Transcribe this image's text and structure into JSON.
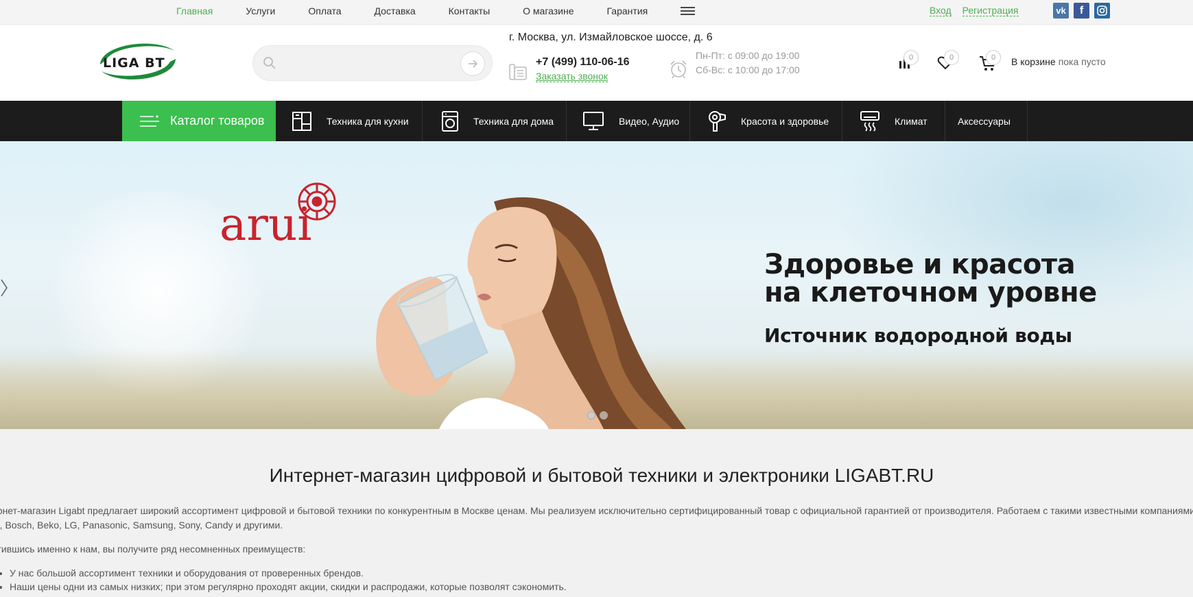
{
  "topnav": {
    "items": [
      {
        "label": "Главная",
        "active": true
      },
      {
        "label": "Услуги"
      },
      {
        "label": "Оплата"
      },
      {
        "label": "Доставка"
      },
      {
        "label": "Контакты"
      },
      {
        "label": "О магазине"
      },
      {
        "label": "Гарантия"
      }
    ],
    "menu_icon": "hamburger-icon",
    "login": "Вход",
    "register": "Регистрация",
    "social": [
      "vk-icon",
      "facebook-icon",
      "instagram-icon"
    ]
  },
  "header": {
    "logo_text": "LIGA BT",
    "search": {
      "placeholder": "",
      "value": ""
    },
    "address": "г. Москва, ул. Измайловское шоссе, д. 6",
    "phone": "+7 (499) 110-06-16",
    "callback": "Заказать звонок",
    "hours_weekdays": "Пн-Пт: с 09:00 до 19:00",
    "hours_weekend": "Сб-Вс: с 10:00 до 17:00",
    "compare_count": "0",
    "favorites_count": "0",
    "cart_count": "0",
    "cart_label": "В корзине",
    "cart_status": "пока пусто"
  },
  "catnav": {
    "catalog_label": "Каталог товаров",
    "items": [
      {
        "label": "Техника для кухни",
        "icon": "kitchen-icon"
      },
      {
        "label": "Техника для дома",
        "icon": "washing-machine-icon"
      },
      {
        "label": "Видео, Аудио",
        "icon": "monitor-icon"
      },
      {
        "label": "Красота и здоровье",
        "icon": "hair-dryer-icon"
      },
      {
        "label": "Климат",
        "icon": "air-conditioner-icon"
      },
      {
        "label": "Аксессуары",
        "icon": ""
      }
    ]
  },
  "hero": {
    "brand": "arui",
    "title": "Здоровье и красота на клеточном уровне",
    "subtitle": "Источник водородной воды",
    "slide_count": 2,
    "active_slide": 1
  },
  "content": {
    "heading": "Интернет-магазин цифровой и бытовой техники и электроники LIGABT.RU",
    "para1_line1": "ернет-магазин Ligabt предлагает широкий ассортимент цифровой и бытовой техники по конкурентным в Москве ценам. Мы реализуем исключительно сертифицированный товар с официальной гарантией от производителя. Работаем с такими известными компаниями",
    "para1_line2": "nt, Bosch, Beko, LG, Panasonic, Samsung, Sony, Candy и другими.",
    "para2": "атившись именно к нам, вы получите ряд несомненных преимуществ:",
    "bullets": [
      "У нас большой ассортимент техники и оборудования от проверенных брендов.",
      "Наши цены одни из самых низких; при этом регулярно проходят акции, скидки и распродажи, которые позволят сэкономить."
    ]
  }
}
